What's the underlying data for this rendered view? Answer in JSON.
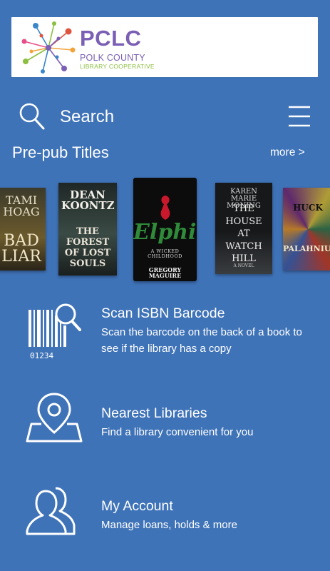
{
  "header": {
    "logo_title": "PCLC",
    "logo_line1": "POLK COUNTY",
    "logo_line2": "LIBRARY COOPERATIVE"
  },
  "search": {
    "label": "Search",
    "icon": "search-icon"
  },
  "menu": {
    "icon": "hamburger-menu-icon"
  },
  "prepub": {
    "title": "Pre-pub Titles",
    "more_label": "more >",
    "books": [
      {
        "author": "TAMI HOAG",
        "title": "BAD LIAR"
      },
      {
        "author": "DEAN KOONTZ",
        "title": "THE FOREST OF LOST SOULS"
      },
      {
        "author": "GREGORY MAGUIRE",
        "title": "Elphie",
        "subtitle": "A WICKED CHILDHOOD"
      },
      {
        "author": "KAREN MARIE MONING",
        "title": "THE HOUSE AT WATCH HILL",
        "subtitle": "A NOVEL"
      },
      {
        "author": "PALAHNIUK",
        "title": "HUCK"
      }
    ]
  },
  "features": [
    {
      "title": "Scan ISBN Barcode",
      "desc": "Scan the barcode on the back of a book to see if the library has a copy",
      "icon": "barcode-scan-icon",
      "barcode_digits": "01234"
    },
    {
      "title": "Nearest Libraries",
      "desc": "Find a library convenient for you",
      "icon": "map-pin-icon"
    },
    {
      "title": "My Account",
      "desc": "Manage loans, holds & more",
      "icon": "users-icon"
    }
  ],
  "colors": {
    "background": "#3f73b8",
    "logo_purple": "#7a5fb4",
    "logo_green": "#8cbf3f"
  }
}
